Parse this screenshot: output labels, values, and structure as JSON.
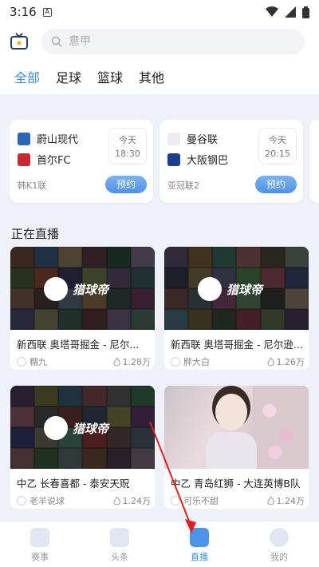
{
  "status": {
    "time": "3:16"
  },
  "search": {
    "placeholder": "意甲"
  },
  "tabs": [
    {
      "label": "全部"
    },
    {
      "label": "足球"
    },
    {
      "label": "篮球"
    },
    {
      "label": "其他"
    }
  ],
  "matches": [
    {
      "team1": "蔚山现代",
      "team2": "首尔FC",
      "day": "今天",
      "time": "18:30",
      "league": "韩K1联",
      "reserve": "预约"
    },
    {
      "team1": "曼谷联",
      "team2": "大阪钢巴",
      "day": "今天",
      "time": "20:15",
      "league": "亚冠联2",
      "reserve": "预约"
    }
  ],
  "section": {
    "title": "正在直播"
  },
  "live": [
    {
      "logo": "猎球帝",
      "title": "新西联 奥塔哥掘金 - 尼尔...",
      "anchor": "糯九",
      "views": "1.28万"
    },
    {
      "logo": "猎球帝",
      "title": "新西联 奥塔哥掘金 - 尼尔逊...",
      "anchor": "胖大白",
      "views": "1.26万"
    },
    {
      "logo": "猎球帝",
      "title": "中乙 长春喜都 - 泰安天贶",
      "anchor": "老羊说球",
      "views": "1.24万"
    },
    {
      "logo": "",
      "title": "中乙 青岛红狮 - 大连英博B队",
      "anchor": "可乐不甜",
      "views": "1.24万"
    }
  ],
  "tabbar": [
    {
      "label": "赛事"
    },
    {
      "label": "头条"
    },
    {
      "label": "直播"
    },
    {
      "label": "我的"
    }
  ],
  "colors": {
    "accent": "#3a8ee6",
    "reserve": "#4e92e6",
    "annotation": "#e02020"
  }
}
